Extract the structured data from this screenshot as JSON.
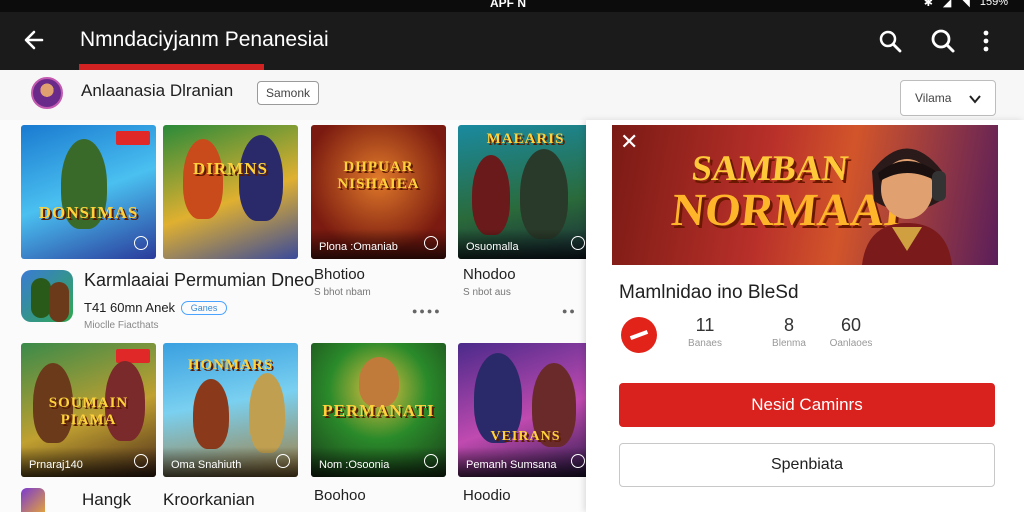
{
  "status_bar": {
    "carrier": "APF N",
    "battery": "159%"
  },
  "app_bar": {
    "title": "Nmndaciyjanm Penanesiai"
  },
  "account": {
    "name": "Anlaanasia Dlranian",
    "chip_label": "Samonk",
    "dropdown_value": "Vilama"
  },
  "grid": {
    "row1": [
      {
        "caption": "",
        "banner_word": "DONSIMAS"
      },
      {
        "caption": "",
        "banner_word": "DIRMNS"
      },
      {
        "caption": "Plona :Omaniab",
        "banner_word": "DHPUAR NISHAIEA"
      },
      {
        "caption": "Osuomalla",
        "banner_word": "MAEARIS"
      }
    ],
    "row2": [
      {
        "caption": "Prnaraj140",
        "banner_word": "SOUMAIN PIAMA"
      },
      {
        "caption": "Oma Snahiuth",
        "banner_word": "HONMARS"
      },
      {
        "caption": "Nom :Osoonia",
        "banner_word": "PERMANATI"
      },
      {
        "caption": "Pemanh Sumsana",
        "banner_word": "VEIRANS"
      }
    ]
  },
  "featured_app": {
    "title": "Karmlaaiai Permumian Dneo",
    "rating_line": "T41 60mn Anek",
    "pill": "Ganes",
    "subline": "Mioclle Fiacthats"
  },
  "meta_items": {
    "col3_title": "Bhotioo",
    "col3_sub": "S bhot nbam",
    "col4_title": "Nhodoo",
    "col4_sub": "S nbot aus",
    "row2_col1_title": "Hangk",
    "row2_col2_title": "Kroorkanian",
    "row2_col3_title": "Boohoo",
    "row2_col4_title": "Hoodio"
  },
  "panel": {
    "banner_line1": "SAMBAN",
    "banner_line2": "NORMAAI",
    "title": "Mamlnidao ino BleSd",
    "stats": [
      {
        "value": "11",
        "label": "Banaes"
      },
      {
        "value": "8",
        "label": "Blenma"
      },
      {
        "value": "60",
        "label": "Oanlaoes"
      }
    ],
    "primary_button": "Nesid Caminrs",
    "secondary_button": "Spenbiata"
  },
  "colors": {
    "accent": "#d9211d",
    "appbar": "#1b1b1b"
  }
}
